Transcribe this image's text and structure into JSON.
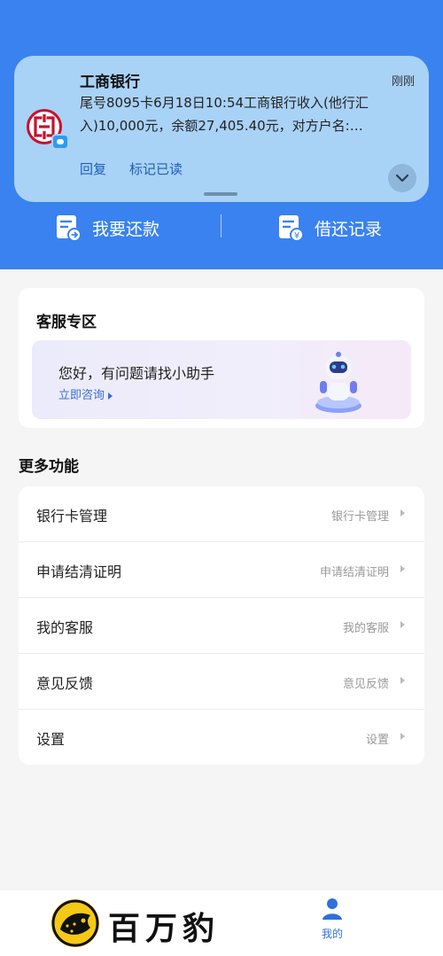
{
  "notification": {
    "app_name": "工商银行",
    "time": "刚刚",
    "message": "尾号8095卡6月18日10:54工商银行收入(他行汇入)10,000元，余额27,405.40元，对方户名:…",
    "actions": {
      "reply": "回复",
      "mark_read": "标记已读"
    }
  },
  "loan_bar": {
    "repay_label": "我要还款",
    "record_label": "借还记录"
  },
  "service": {
    "title": "客服专区",
    "assistant_title": "您好，有问题请找小助手",
    "assistant_link": "立即咨询"
  },
  "more": {
    "title": "更多功能",
    "items": [
      {
        "label": "银行卡管理",
        "hint": "银行卡管理"
      },
      {
        "label": "申请结清证明",
        "hint": "申请结清证明"
      },
      {
        "label": "我的客服",
        "hint": "我的客服"
      },
      {
        "label": "意见反馈",
        "hint": "意见反馈"
      },
      {
        "label": "设置",
        "hint": "设置"
      }
    ]
  },
  "tabbar": {
    "brand_text": "百万豹",
    "mine_label": "我的"
  },
  "colors": {
    "header_blue": "#3a82f0",
    "accent_link": "#3a6fd8",
    "icbc_red": "#c8102e",
    "brand_yellow": "#f6c915"
  },
  "icons": [
    "icbc-logo-icon",
    "chat-badge-icon",
    "chevron-down-icon",
    "repay-doc-icon",
    "record-doc-icon",
    "robot-icon",
    "chevron-right-icon",
    "leopard-logo-icon",
    "user-icon"
  ]
}
